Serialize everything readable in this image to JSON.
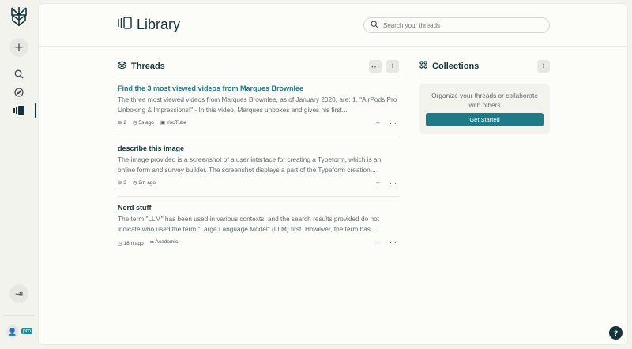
{
  "sidebar": {
    "pro_badge": "pro"
  },
  "header": {
    "title": "Library",
    "search_placeholder": "Search your threads"
  },
  "threads": {
    "heading": "Threads",
    "items": [
      {
        "title": "Find the 3 most viewed videos from Marques Brownlee",
        "snippet": "The three most viewed videos from Marques Brownlee, as of January 2020, are: 1. \"AirPods Pro Unboxing & Impressions!\" - In this video, Marques unboxes and gives his first...",
        "count": "2",
        "time": "5s ago",
        "source": "YouTube"
      },
      {
        "title": "describe this image",
        "snippet": "The image provided is a screenshot of a user interface for creating a Typeform, which is an online form and survey builder. The screenshot displays a part of the Typeform creation...",
        "count": "3",
        "time": "2m ago"
      },
      {
        "title": "Nerd stuff",
        "snippet": "The term \"LLM\" has been used in various contexts, and the search results provided do not indicate who used the term \"Large Language Model\" (LLM) first. However, the term has...",
        "time": "18m ago",
        "source": "Academic"
      }
    ]
  },
  "collections": {
    "heading": "Collections",
    "empty_text": "Organize your threads or collaborate with others",
    "cta": "Get Started"
  },
  "help": "?"
}
